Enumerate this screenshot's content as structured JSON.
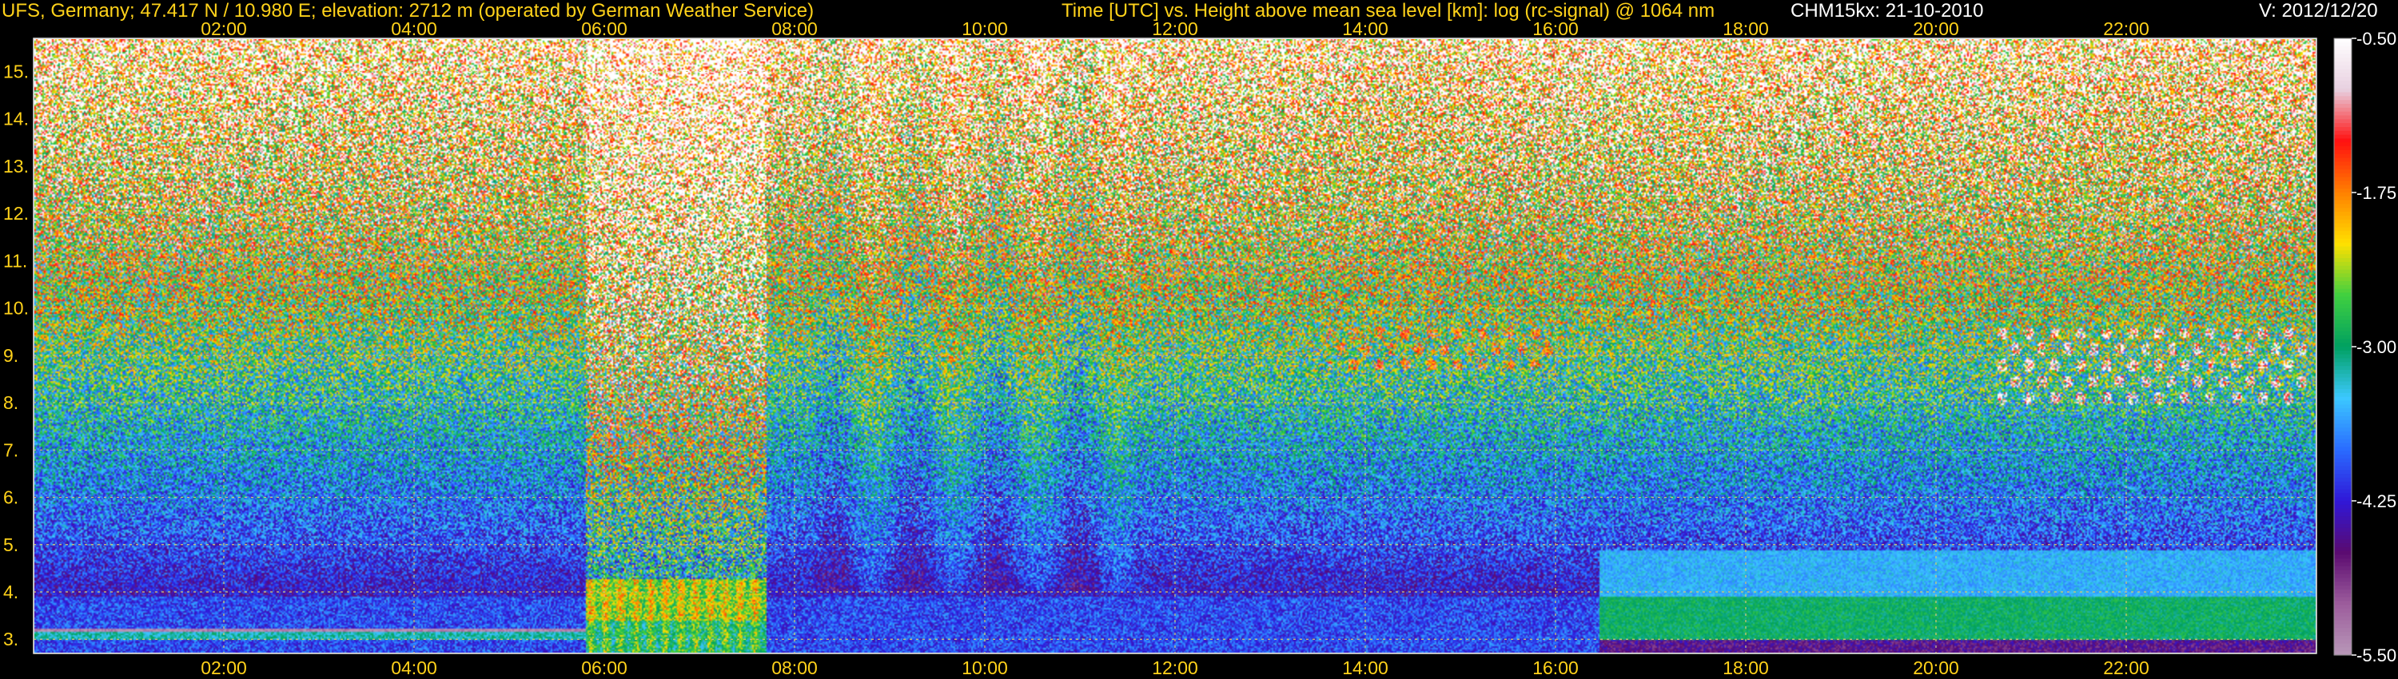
{
  "header": {
    "station": "UFS, Germany; 47.417 N / 10.980 E; elevation: 2712 m  (operated by German Weather Service)",
    "axes_title": "Time [UTC] vs. Height above mean sea level [km]: log (rc-signal) @ 1064 nm",
    "instrument": "CHM15kx: 21-10-2010",
    "version": "V: 2012/12/20"
  },
  "chart_data": {
    "type": "heatmap",
    "xlabel": "Time [UTC]",
    "ylabel": "Height above mean sea level [km]",
    "xlim": [
      0,
      24
    ],
    "ylim": [
      2.7,
      15.7
    ],
    "x_ticks": [
      "02:00",
      "04:00",
      "06:00",
      "08:00",
      "10:00",
      "12:00",
      "14:00",
      "16:00",
      "18:00",
      "20:00",
      "22:00"
    ],
    "x_tick_values": [
      2,
      4,
      6,
      8,
      10,
      12,
      14,
      16,
      18,
      20,
      22
    ],
    "y_ticks": [
      "3.",
      "4.",
      "5.",
      "6.",
      "7.",
      "8.",
      "9.",
      "10.",
      "11.",
      "12.",
      "13.",
      "14.",
      "15."
    ],
    "y_tick_values": [
      3,
      4,
      5,
      6,
      7,
      8,
      9,
      10,
      11,
      12,
      13,
      14,
      15
    ],
    "grid": true,
    "colorbar": {
      "label": "log (rc-signal)",
      "min": -5.5,
      "max": -0.5,
      "tick_labels": [
        "-0.50",
        "-1.75",
        "-3.00",
        "-4.25",
        "-5.50"
      ],
      "tick_values": [
        -0.5,
        -1.75,
        -3.0,
        -4.25,
        -5.5
      ],
      "colors": [
        "#b898b8",
        "#9c5c9c",
        "#5a0a70",
        "#3018d8",
        "#2a6cff",
        "#3cc8ff",
        "#00a060",
        "#40d040",
        "#ffe000",
        "#ff8000",
        "#ff1010",
        "#e8d0e0",
        "#ffffff"
      ]
    },
    "features": [
      {
        "name": "boundary layer aerosol",
        "time_start": 5.8,
        "time_end": 7.7,
        "height_top": 4.3,
        "signal": -1.6
      },
      {
        "name": "noisy daytime column",
        "time_start": 5.8,
        "time_end": 7.7,
        "height_top": 15.7,
        "signal": -0.6
      },
      {
        "name": "cirrus clouds",
        "time_start": 13.6,
        "time_end": 16.0,
        "height_bottom": 8.7,
        "height_top": 9.6,
        "signal": -1.5
      },
      {
        "name": "cirrus clouds",
        "time_start": 20.6,
        "time_end": 23.9,
        "height_bottom": 7.9,
        "height_top": 9.6,
        "signal": -0.8
      },
      {
        "name": "elevated aerosol layer",
        "time_start": 16.45,
        "time_end": 24.0,
        "height_bottom": 3.0,
        "height_top": 4.9,
        "signal": -3.2
      },
      {
        "name": "low-level clouds",
        "time_start": 0.0,
        "time_end": 5.8,
        "height_bottom": 3.0,
        "height_top": 3.3,
        "signal": -4.2
      }
    ]
  }
}
